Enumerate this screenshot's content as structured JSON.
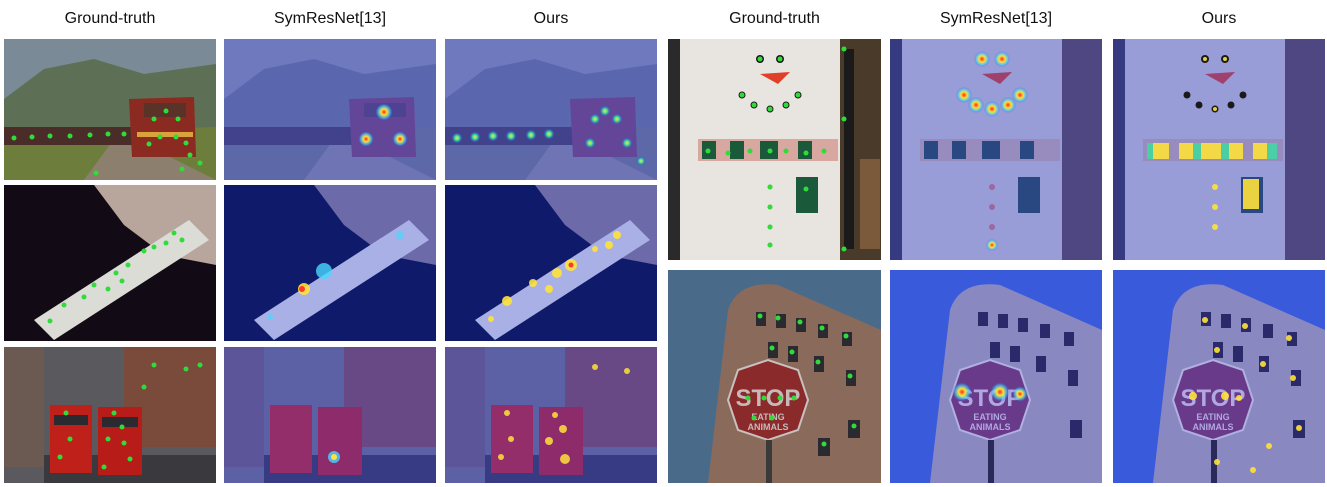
{
  "headers": {
    "left": [
      "Ground-truth",
      "SymResNet[13]",
      "Ours"
    ],
    "right": [
      "Ground-truth",
      "SymResNet[13]",
      "Ours"
    ]
  },
  "image_labels": {
    "stop_sign": "STOP",
    "stop_sub1": "EATING",
    "stop_sub2": "ANIMALS"
  },
  "colors": {
    "gt_dot": "#2fdc3a",
    "heat_overlay": "#2a3fd6",
    "heat_hot": "#ff2a1a",
    "heat_warm": "#ffe23a"
  },
  "icons": [
    "train-scene",
    "wii-remote-scene",
    "street-buses-scene",
    "snowman-fridge-scene",
    "stop-sign-building-scene"
  ]
}
